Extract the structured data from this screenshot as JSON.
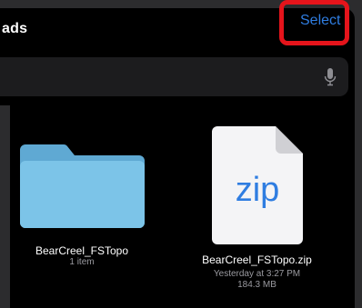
{
  "header": {
    "title": "ads",
    "select_label": "Select"
  },
  "search": {
    "placeholder": "",
    "mic_icon": "microphone-icon"
  },
  "files": [
    {
      "name": "BearCreel_FSTopo",
      "detail1": "1 item",
      "icon": "folder-icon"
    },
    {
      "name": "BearCreel_FSTopo.zip",
      "detail1": "Yesterday at 3:27 PM",
      "detail2": "184.3 MB",
      "icon": "zip-file-icon",
      "badge": "zip"
    }
  ],
  "colors": {
    "accent": "#2f7de1",
    "highlight": "#e5141b",
    "folder": "#7cc4e8"
  }
}
